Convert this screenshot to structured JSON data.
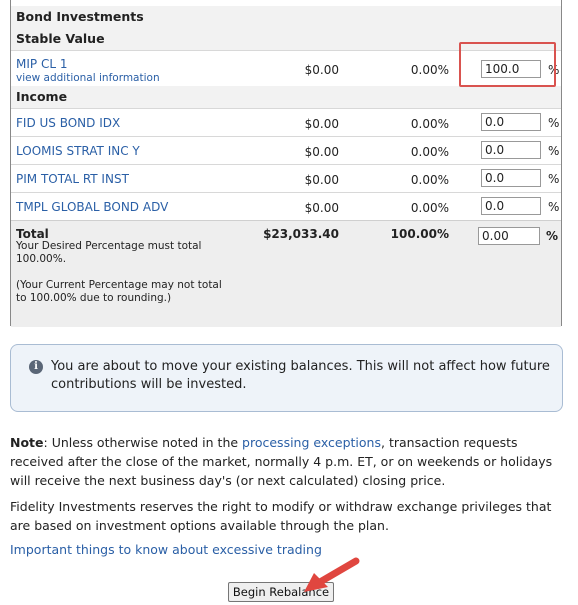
{
  "table": {
    "section_bond": "Bond Investments",
    "section_stable": "Stable Value",
    "section_income": "Income",
    "stable_funds": [
      {
        "name": "MIP CL 1",
        "sub": "view additional information",
        "amount": "$0.00",
        "current_pct": "0.00%",
        "desired": "100.0"
      }
    ],
    "income_funds": [
      {
        "name": "FID US BOND IDX",
        "amount": "$0.00",
        "current_pct": "0.00%",
        "desired": "0.0"
      },
      {
        "name": "LOOMIS STRAT INC Y",
        "amount": "$0.00",
        "current_pct": "0.00%",
        "desired": "0.0"
      },
      {
        "name": "PIM TOTAL RT INST",
        "amount": "$0.00",
        "current_pct": "0.00%",
        "desired": "0.0"
      },
      {
        "name": "TMPL GLOBAL BOND ADV",
        "amount": "$0.00",
        "current_pct": "0.00%",
        "desired": "0.0"
      }
    ],
    "pct_symbol": "%",
    "total": {
      "label": "Total",
      "note1": "Your Desired Percentage must total 100.00%.",
      "note2": "(Your Current Percentage may not total to 100.00% due to rounding.)",
      "amount": "$23,033.40",
      "current_pct": "100.00%",
      "desired": "0.00"
    }
  },
  "notice": {
    "icon": "info-icon",
    "text": "You are about to move your existing balances. This will not affect how future contributions will be invested."
  },
  "note": {
    "label": "Note",
    "pre": ": Unless otherwise noted in the ",
    "link": "processing exceptions",
    "post": ", transaction requests received after the close of the market, normally 4 p.m. ET, or on weekends or holidays will receive the next business day's (or next calculated) closing price."
  },
  "rights_text": "Fidelity Investments reserves the right to modify or withdraw exchange privileges that are based on investment options available through the plan.",
  "trading_link": "Important things to know about excessive trading",
  "button": {
    "label": "Begin Rebalance"
  },
  "colors": {
    "link": "#2a5fa6",
    "highlight": "#d9534f",
    "notice_bg": "#eef3f9"
  }
}
